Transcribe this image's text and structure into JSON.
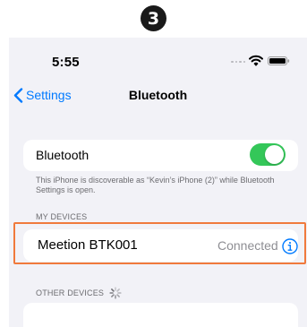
{
  "step": {
    "number": "3"
  },
  "status_bar": {
    "time": "5:55"
  },
  "nav": {
    "back_label": "Settings",
    "title": "Bluetooth"
  },
  "bluetooth": {
    "label": "Bluetooth",
    "enabled": true,
    "footnote": "This iPhone is discoverable as “Kevin’s iPhone (2)” while Bluetooth Settings is open."
  },
  "my_devices": {
    "header": "MY DEVICES",
    "items": [
      {
        "name": "Meetion BTK001",
        "status": "Connected",
        "icon": "info-icon"
      }
    ]
  },
  "other_devices": {
    "header": "OTHER DEVICES",
    "icon": "loading-spinner-icon"
  },
  "colors": {
    "accent": "#007aff",
    "toggle_on": "#34c759",
    "highlight": "#f07a3c",
    "background": "#f2f2f7"
  }
}
